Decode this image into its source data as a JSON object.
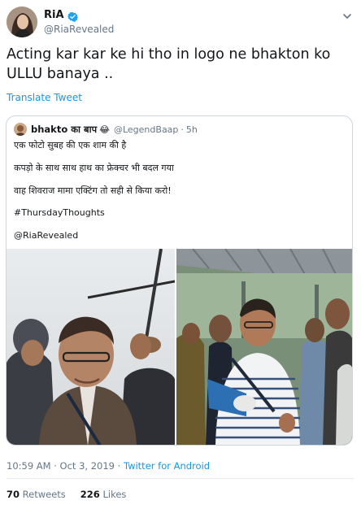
{
  "author": {
    "display_name": "RiA",
    "handle": "@RiaRevealed",
    "verified": true
  },
  "tweet": {
    "text": "Acting kar kar ke hi tho in logo ne bhakton ko ULLU banaya ..",
    "translate_label": "Translate Tweet"
  },
  "quoted_tweet": {
    "display_name": "bhakto का बाप",
    "emoji": "😂",
    "handle": "@LegendBaap",
    "separator": "·",
    "time": "5h",
    "lines": [
      "एक फोटो सुबह की एक शाम की है",
      "कपड़ो के साथ साथ हाथ का फ्रेक्चर भी बदल गया",
      "वाह शिवराज मामा एक्टिंग तो सही से किया करो!",
      "#ThursdayThoughts",
      "@RiaRevealed"
    ]
  },
  "meta": {
    "timestamp": "10:59 AM · Oct 3, 2019 · ",
    "app": "Twitter for Android"
  },
  "stats": {
    "retweets_count": "70",
    "retweets_label": "Retweets",
    "likes_count": "226",
    "likes_label": "Likes"
  },
  "colors": {
    "link": "#1b95e0",
    "secondary_text": "#657786",
    "border": "#ccd6dd",
    "verified": "#1da1f2"
  },
  "icons": {
    "verified": "verified-badge-icon",
    "caret": "chevron-down-icon"
  }
}
